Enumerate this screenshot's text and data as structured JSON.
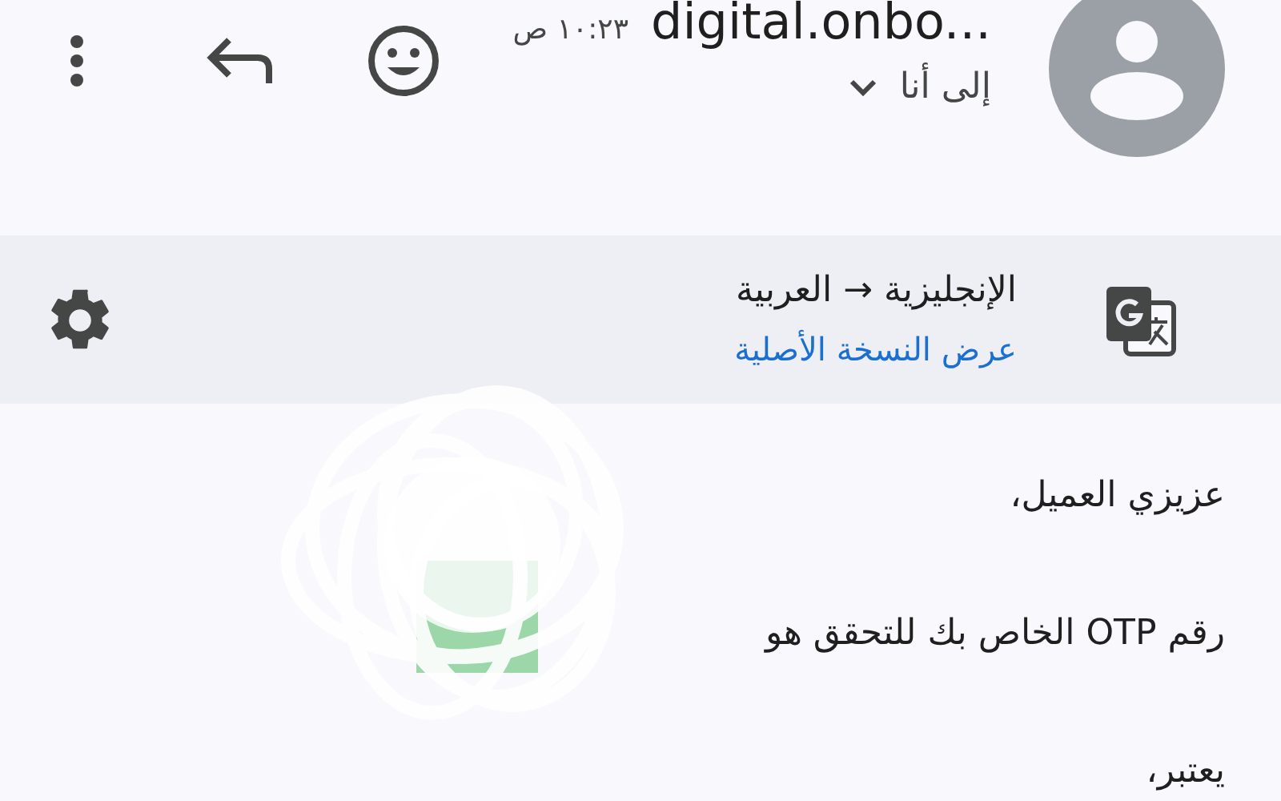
{
  "header": {
    "sender": "digital.onbo...",
    "time": "١٠:٢٣ ص",
    "recipient": "إلى أنا"
  },
  "translation_bar": {
    "languages": "الإنجليزية → العربية",
    "link": "عرض النسخة الأصلية"
  },
  "body": [
    "عزيزي العميل،",
    "رقم OTP الخاص بك للتحقق هو",
    "يعتبر،"
  ]
}
